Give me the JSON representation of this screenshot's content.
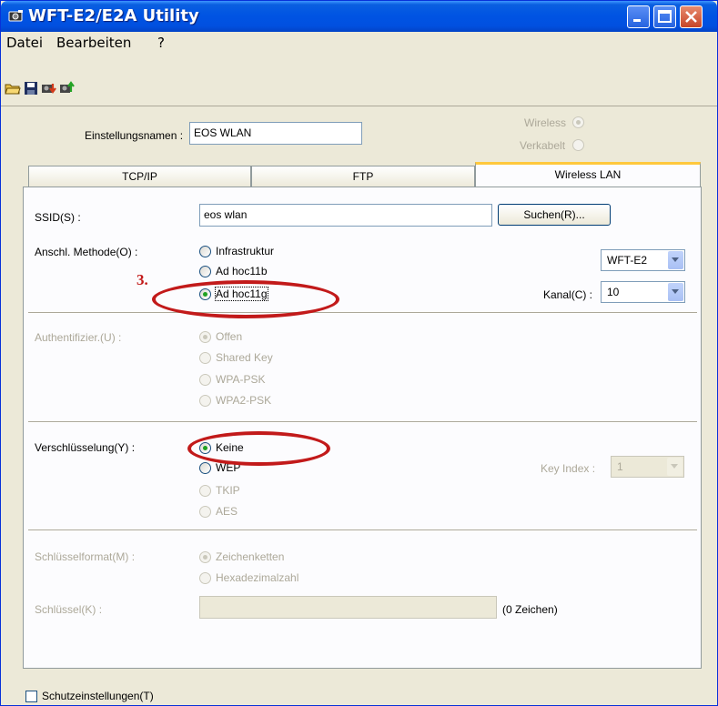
{
  "window": {
    "title": "WFT-E2/E2A Utility",
    "icon": "app-icon",
    "buttons": [
      "minimize-icon",
      "maximize-icon",
      "close-icon"
    ]
  },
  "menu": {
    "items": [
      "Datei",
      "Bearbeiten",
      "?"
    ]
  },
  "toolbar": {
    "icons": [
      "open-folder-icon",
      "save-icon",
      "import-icon",
      "export-icon"
    ]
  },
  "header": {
    "settings_name_label": "Einstellungsnamen :",
    "settings_name_value": "EOS WLAN",
    "wireless_label": "Wireless",
    "wired_label": "Verkabelt"
  },
  "tabs": [
    {
      "label": "TCP/IP",
      "active": false
    },
    {
      "label": "FTP",
      "active": false
    },
    {
      "label": "Wireless LAN",
      "active": true
    }
  ],
  "wlan": {
    "ssid_label": "SSID(S) :",
    "ssid_value": "eos wlan",
    "search_button": "Suchen(R)...",
    "method_label": "Anschl. Methode(O) :",
    "methods": [
      "Infrastruktur",
      "Ad hoc11b",
      "Ad hoc11g"
    ],
    "method_selected": "Ad hoc11g",
    "device_select": "WFT-E2",
    "channel_label": "Kanal(C) :",
    "channel_value": "10",
    "auth_label": "Authentifizier.(U) :",
    "auth_options": [
      "Offen",
      "Shared Key",
      "WPA-PSK",
      "WPA2-PSK"
    ],
    "encryption_label": "Verschlüsselung(Y) :",
    "encryption_options": [
      "Keine",
      "WEP",
      "TKIP",
      "AES"
    ],
    "encryption_selected": "Keine",
    "key_index_label": "Key Index :",
    "key_index_value": "1",
    "key_format_label": "Schlüsselformat(M) :",
    "key_format_options": [
      "Zeichenketten",
      "Hexadezimalzahl"
    ],
    "key_label": "Schlüssel(K) :",
    "key_count": "(0 Zeichen)"
  },
  "footer": {
    "protect_label": "Schutzeinstellungen(T)"
  },
  "annotation": {
    "step_number": "3.",
    "color": "#c21a1a"
  }
}
